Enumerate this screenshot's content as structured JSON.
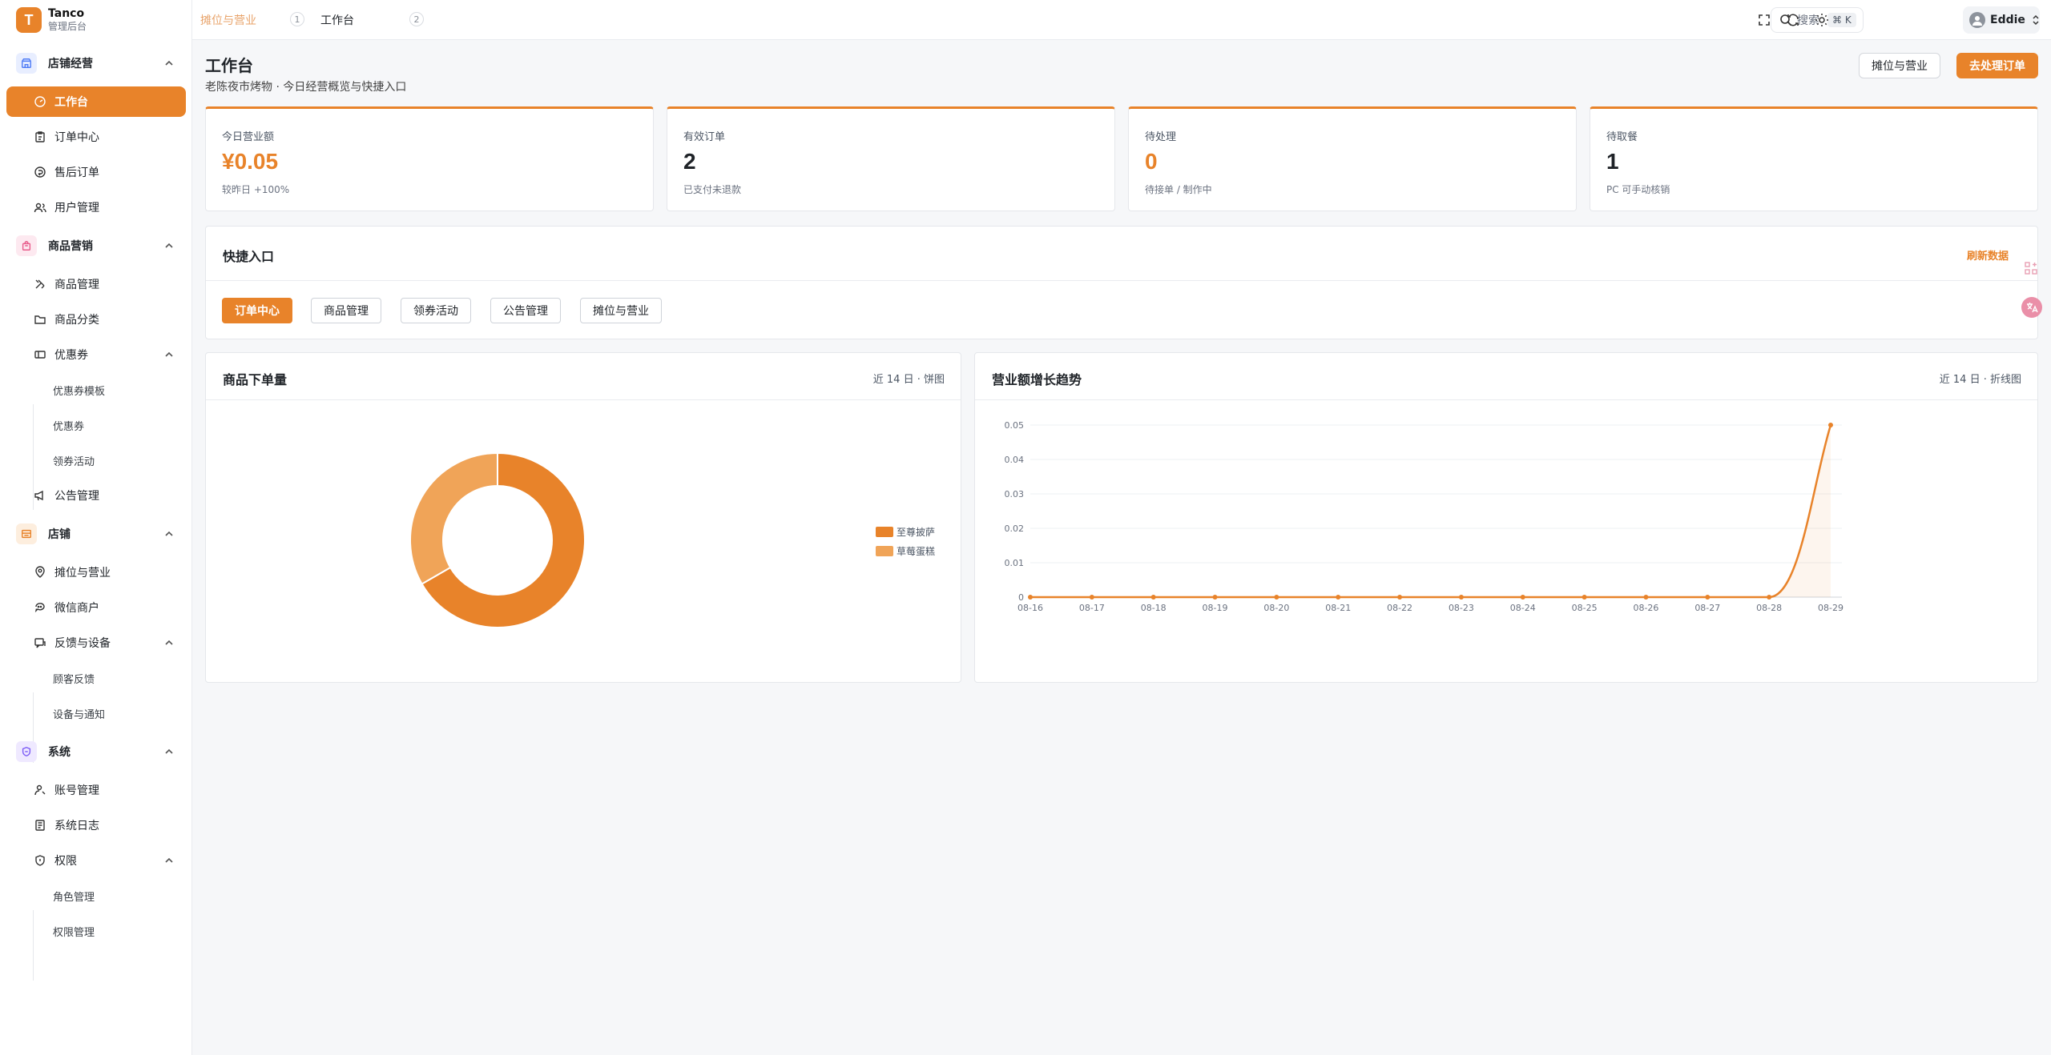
{
  "brand": {
    "name": "Tanco",
    "subtitle": "管理后台",
    "logo_letter": "T"
  },
  "sidebar": {
    "groups": [
      {
        "label": "店铺经营",
        "icon": "store-icon",
        "color": "#4f7cf6"
      },
      {
        "label": "商品营销",
        "icon": "bag-icon",
        "color": "#e85d8c"
      },
      {
        "label": "店铺",
        "icon": "shop-icon",
        "color": "#e8832a"
      },
      {
        "label": "系统",
        "icon": "shield-icon",
        "color": "#7c5cf6"
      }
    ],
    "items": [
      {
        "label": "工作台",
        "icon": "dashboard-icon",
        "active": true
      },
      {
        "label": "订单中心",
        "icon": "clipboard-icon"
      },
      {
        "label": "售后订单",
        "icon": "refund-icon"
      },
      {
        "label": "用户管理",
        "icon": "users-icon"
      },
      {
        "label": "商品管理",
        "icon": "tools-icon"
      },
      {
        "label": "商品分类",
        "icon": "folder-icon"
      },
      {
        "label": "优惠券",
        "icon": "ticket-icon"
      },
      {
        "label": "优惠券模板"
      },
      {
        "label": "优惠券"
      },
      {
        "label": "领券活动"
      },
      {
        "label": "公告管理",
        "icon": "megaphone-icon"
      },
      {
        "label": "摊位与营业",
        "icon": "location-icon"
      },
      {
        "label": "微信商户",
        "icon": "wechat-icon"
      },
      {
        "label": "反馈与设备",
        "icon": "feedback-icon"
      },
      {
        "label": "顾客反馈"
      },
      {
        "label": "设备与通知"
      },
      {
        "label": "账号管理",
        "icon": "user-key-icon"
      },
      {
        "label": "系统日志",
        "icon": "log-icon"
      },
      {
        "label": "权限",
        "icon": "shield-small-icon"
      },
      {
        "label": "角色管理"
      },
      {
        "label": "权限管理"
      }
    ]
  },
  "topbar": {
    "tabs": [
      {
        "label": "摊位与营业",
        "active": true
      },
      {
        "label": "1"
      },
      {
        "label": "工作台"
      },
      {
        "label": "2"
      }
    ],
    "search_placeholder": "搜索",
    "search_shortcut": "⌘ K",
    "user_name": "Eddie"
  },
  "page": {
    "title": "工作台",
    "subtitle": "老陈夜市烤物 · 今日经营概览与快捷入口",
    "btn_stall": "摊位与营业",
    "btn_orders": "去处理订单"
  },
  "stats": [
    {
      "label": "今日营业额",
      "value": "¥0.05",
      "note": "较昨日 +100%",
      "accent": true
    },
    {
      "label": "有效订单",
      "value": "2",
      "note": "已支付未退款",
      "accent": false
    },
    {
      "label": "待处理",
      "value": "0",
      "note": "待接单 / 制作中",
      "accent": true
    },
    {
      "label": "待取餐",
      "value": "1",
      "note": "PC 可手动核销",
      "accent": false
    }
  ],
  "quick": {
    "title": "快捷入口",
    "refresh": "刷新数据",
    "buttons": [
      "订单中心",
      "商品管理",
      "领券活动",
      "公告管理",
      "摊位与营业"
    ]
  },
  "pie_card": {
    "title": "商品下单量",
    "meta": "近 14 日 · 饼图"
  },
  "line_card": {
    "title": "营业额增长趋势",
    "meta": "近 14 日 · 折线图"
  },
  "colors": {
    "accent": "#e8832a",
    "accent_light": "#f0a458"
  },
  "chart_data": [
    {
      "type": "pie",
      "donut": true,
      "labels": [
        "至尊披萨",
        "草莓蛋糕"
      ],
      "values": [
        2,
        1
      ],
      "colors": [
        "#e8832a",
        "#f0a458"
      ],
      "legend": "right"
    },
    {
      "type": "area",
      "x": [
        "08-16",
        "08-17",
        "08-18",
        "08-19",
        "08-20",
        "08-21",
        "08-22",
        "08-23",
        "08-24",
        "08-25",
        "08-26",
        "08-27",
        "08-28",
        "08-29"
      ],
      "y": [
        0,
        0,
        0,
        0,
        0,
        0,
        0,
        0,
        0,
        0,
        0,
        0,
        0,
        0.05
      ],
      "ylim": [
        0,
        0.05
      ],
      "yticks": [
        "0",
        "0.01",
        "0.02",
        "0.03",
        "0.04",
        "0.05"
      ],
      "grid": true,
      "color": "#e8832a"
    }
  ]
}
